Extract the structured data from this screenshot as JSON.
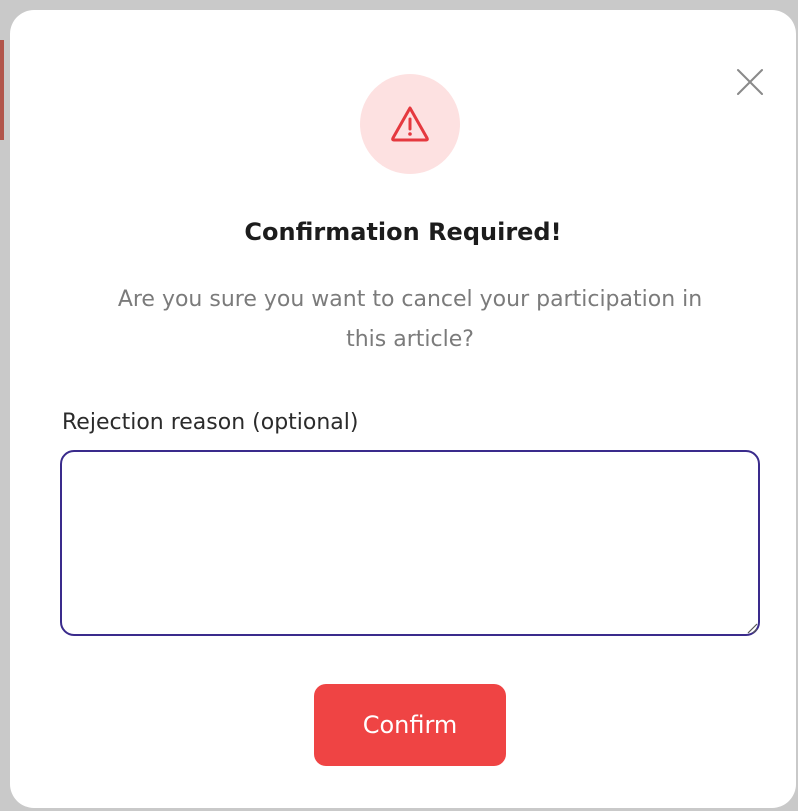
{
  "modal": {
    "title": "Confirmation Required!",
    "message": "Are you sure you want to cancel your participation in this article?",
    "close_icon": "close-icon",
    "warning_icon": "warning-triangle-icon",
    "field": {
      "label": "Rejection reason (optional)",
      "value": "",
      "placeholder": ""
    },
    "confirm_label": "Confirm"
  },
  "colors": {
    "accent_red": "#ef4444",
    "warning_bg": "#fde1e1",
    "focus_border": "#3a2b8c",
    "muted_text": "#7b7b7b"
  }
}
